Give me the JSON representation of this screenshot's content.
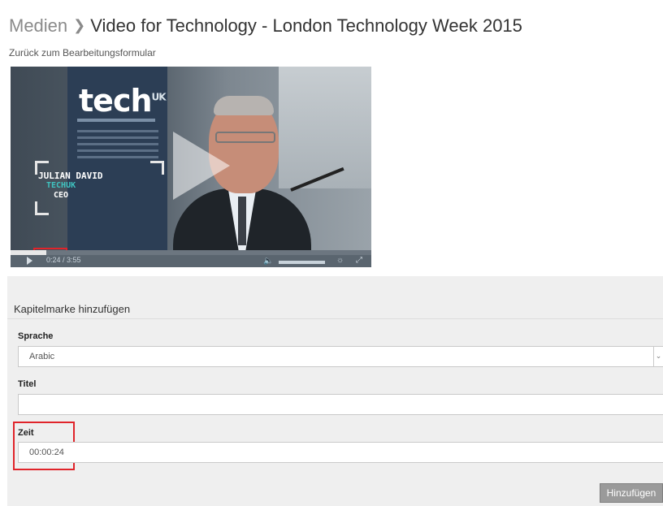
{
  "breadcrumb": {
    "section": "Medien",
    "separator": "❯",
    "title": "Video for Technology - London Technology Week 2015"
  },
  "back_link": "Zurück zum Bearbeitungsformular",
  "video": {
    "banner_logo": "tech",
    "banner_logo_sup": "UK",
    "speaker_name": "JULIAN DAVID",
    "speaker_org": "TECHUK",
    "speaker_role": "CEO",
    "time_display": "0:24 / 3:55",
    "progress_fraction": 0.1
  },
  "form": {
    "heading": "Kapitelmarke hinzufügen",
    "language_label": "Sprache",
    "language_value": "Arabic",
    "title_label": "Titel",
    "title_value": "",
    "time_label": "Zeit",
    "time_value": "00:00:24",
    "submit_label": "Hinzufügen"
  },
  "colors": {
    "highlight": "#e0242a",
    "panel_bg": "#efefef",
    "button_bg": "#9a9a9a"
  },
  "icons": {
    "separator": "chevron-right-icon",
    "play": "play-icon",
    "volume": "volume-icon",
    "light": "light-bulb-icon",
    "fullscreen": "fullscreen-icon",
    "select": "chevron-down-icon"
  }
}
